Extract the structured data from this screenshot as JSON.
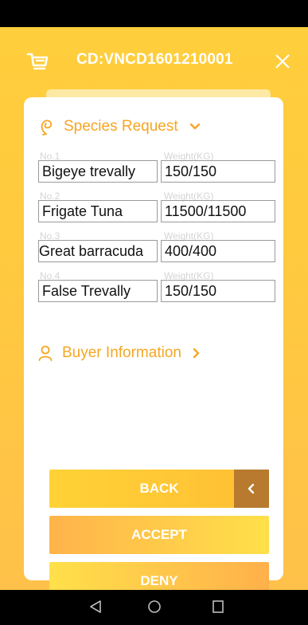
{
  "header": {
    "title": "CD:VNCD1601210001",
    "cart_icon": "cart-icon",
    "close_icon": "close-icon"
  },
  "species_section": {
    "title": "Species Request",
    "rows": [
      {
        "no": "No.1",
        "weight_label": "Weight(KG)",
        "name": "Bigeye trevally",
        "weight": "150/150"
      },
      {
        "no": "No.2",
        "weight_label": "Weight(KG)",
        "name": "Frigate Tuna",
        "weight": "11500/11500"
      },
      {
        "no": "No.3",
        "weight_label": "Weight(KG)",
        "name": "Great barracuda",
        "weight": "400/400"
      },
      {
        "no": "No.4",
        "weight_label": "Weight(KG)",
        "name": "False Trevally",
        "weight": "150/150"
      }
    ]
  },
  "buyer_section": {
    "title": "Buyer Information"
  },
  "buttons": {
    "back": "BACK",
    "accept": "ACCEPT",
    "deny": "DENY"
  },
  "colors": {
    "accent": "#f5a623",
    "header_bg": "#ffce3c",
    "back_arrow_bg": "#b77a2e"
  }
}
